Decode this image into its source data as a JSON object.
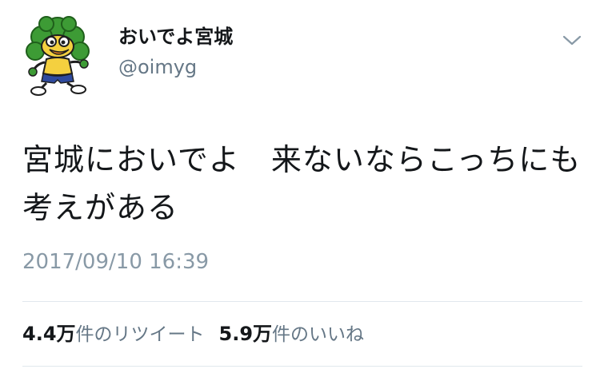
{
  "tweet": {
    "display_name": "おいでよ宮城",
    "handle": "@oimyg",
    "avatar_icon": "mascot-avatar-icon",
    "menu_icon": "chevron-down-icon",
    "text": "宮城においでよ　来ないならこっちにも考えがある",
    "timestamp": "2017/09/10 16:39"
  },
  "stats": {
    "retweets_count": "4.4万",
    "retweets_label": "件のリツイート",
    "likes_count": "5.9万",
    "likes_label": "件のいいね"
  },
  "colors": {
    "text_primary": "#14171a",
    "text_secondary": "#657786",
    "timestamp": "#8899a6",
    "divider": "#e1e8ed",
    "mascot_green": "#3d9b35"
  }
}
